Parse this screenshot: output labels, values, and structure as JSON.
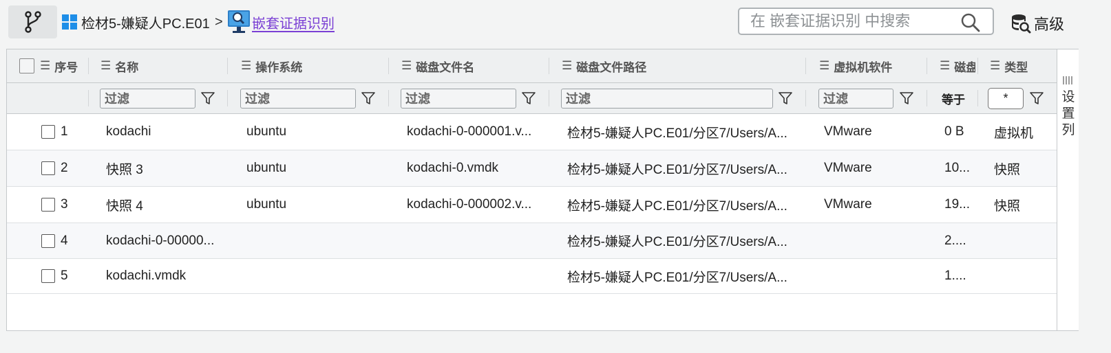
{
  "breadcrumb": {
    "root": "检材5-嫌疑人PC.E01",
    "separator": ">",
    "current": "嵌套证据识别"
  },
  "search": {
    "placeholder": "在 嵌套证据识别 中搜索",
    "value": ""
  },
  "advanced_label": "高级",
  "columns": [
    "序号",
    "名称",
    "操作系统",
    "磁盘文件名",
    "磁盘文件路径",
    "虚拟机软件",
    "磁盘",
    "类型"
  ],
  "filters": {
    "placeholder": "过滤",
    "size_operator": "等于",
    "type_value": "*"
  },
  "side_panel_label": "设置列",
  "rows": [
    {
      "num": "1",
      "name": "kodachi",
      "os": "ubuntu",
      "file": "kodachi-0-000001.v...",
      "path": "检材5-嫌疑人PC.E01/分区7/Users/A...",
      "vm": "VMware",
      "size": "0 B",
      "type": "虚拟机"
    },
    {
      "num": "2",
      "name": "快照 3",
      "os": "ubuntu",
      "file": "kodachi-0.vmdk",
      "path": "检材5-嫌疑人PC.E01/分区7/Users/A...",
      "vm": "VMware",
      "size": "10...",
      "type": "快照"
    },
    {
      "num": "3",
      "name": "快照 4",
      "os": "ubuntu",
      "file": "kodachi-0-000002.v...",
      "path": "检材5-嫌疑人PC.E01/分区7/Users/A...",
      "vm": "VMware",
      "size": "19...",
      "type": "快照"
    },
    {
      "num": "4",
      "name": "kodachi-0-00000...",
      "os": "",
      "file": "",
      "path": "检材5-嫌疑人PC.E01/分区7/Users/A...",
      "vm": "",
      "size": "2....",
      "type": ""
    },
    {
      "num": "5",
      "name": "kodachi.vmdk",
      "os": "",
      "file": "",
      "path": "检材5-嫌疑人PC.E01/分区7/Users/A...",
      "vm": "",
      "size": "1....",
      "type": ""
    }
  ],
  "colors": {
    "link": "#7a3fd4",
    "windows_blue": "#1e8ee8"
  }
}
